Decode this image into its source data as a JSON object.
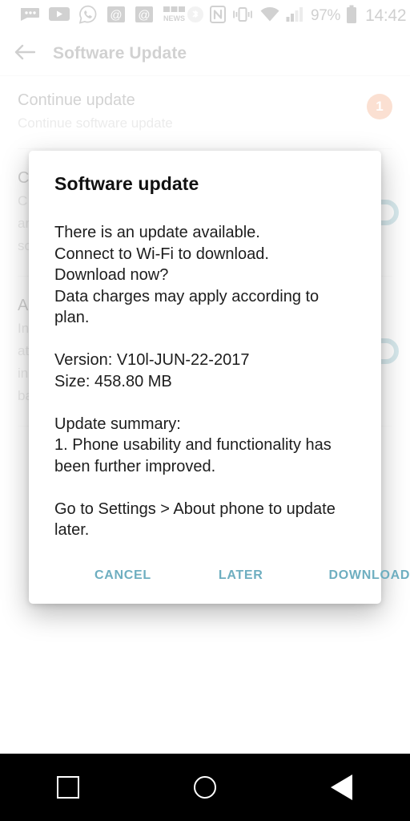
{
  "statusbar": {
    "icons_left": [
      "messaging-dots-icon",
      "youtube-icon",
      "whatsapp-icon",
      "email-at-icon",
      "email-at-2-icon",
      "bbc-news-icon"
    ],
    "bbc_label": "BBC",
    "news_label": "NEWS",
    "icons_right": [
      "bluetooth-icon",
      "nfc-icon",
      "vibrate-icon",
      "wifi-icon",
      "signal-icon"
    ],
    "battery_percent": "97%",
    "time": "14:42"
  },
  "appbar": {
    "back_icon": "back-arrow-icon",
    "title": "Software Update"
  },
  "list": {
    "items": [
      {
        "title": "Continue update",
        "subtitle": "Continue software update",
        "badge": "1"
      },
      {
        "title": "C",
        "sub1": "C",
        "sub2": "an",
        "sub3": "so",
        "toggle": "on"
      },
      {
        "title": "A",
        "sub1": "In",
        "sub2": "at",
        "sub3": "in",
        "sub4": "ba",
        "toggle": "on"
      }
    ]
  },
  "dialog": {
    "title": "Software update",
    "body": "There is an update available.\nConnect to Wi-Fi to download.\nDownload now?\nData charges may apply according to plan.\n\nVersion: V10l-JUN-22-2017\nSize: 458.80 MB\n\nUpdate summary:\n1. Phone usability and functionality has been further improved.\n\nGo to Settings > About phone to update later.",
    "version": "V10l-JUN-22-2017",
    "size": "458.80 MB",
    "buttons": {
      "cancel": "CANCEL",
      "later": "LATER",
      "download": "DOWNLOAD"
    }
  },
  "navbar": {
    "recents": "recents-square-icon",
    "home": "home-circle-icon",
    "back": "back-triangle-icon"
  },
  "colors": {
    "badge_orange": "#e8661f",
    "action_teal": "#6eaec0",
    "toggle_teal": "#3b93a5",
    "navbar_black": "#000000"
  }
}
